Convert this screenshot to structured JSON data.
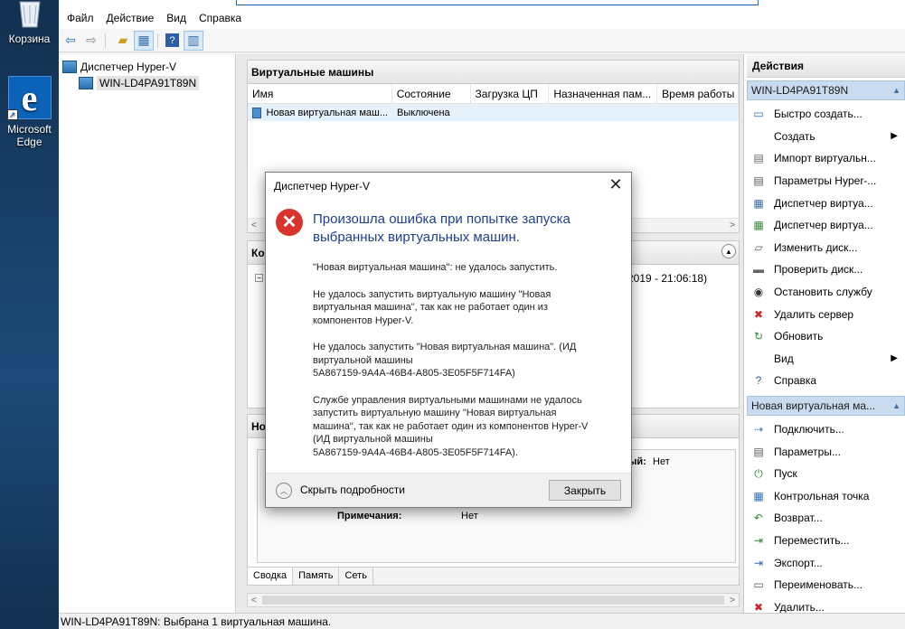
{
  "desktop": {
    "recycle_bin": "Корзина",
    "edge": "Microsoft Edge"
  },
  "menu": [
    "Файл",
    "Действие",
    "Вид",
    "Справка"
  ],
  "tree": {
    "root": "Диспетчер Hyper-V",
    "server": "WIN-LD4PA91T89N"
  },
  "vm_panel": {
    "title": "Виртуальные машины",
    "columns": [
      "Имя",
      "Состояние",
      "Загрузка ЦП",
      "Назначенная пам...",
      "Время работы"
    ],
    "rows": [
      {
        "name": "Новая виртуальная маш...",
        "state": "Выключена",
        "cpu": "",
        "mem": "",
        "uptime": ""
      }
    ]
  },
  "checkpoints_panel": {
    "title": "Ко",
    "date": "2019 - 21:06:18)"
  },
  "details_panel": {
    "title": "Но",
    "net_label": "ый:",
    "net_value": "Нет",
    "notes_label": "Примечания:",
    "notes_value": "Нет",
    "tabs": [
      "Сводка",
      "Память",
      "Сеть"
    ]
  },
  "actions": {
    "header": "Действия",
    "server_section": "WIN-LD4PA91T89N",
    "server_items": [
      {
        "label": "Быстро создать...",
        "icon": "quick-create-icon",
        "sub": false
      },
      {
        "label": "Создать",
        "icon": "none",
        "sub": true
      },
      {
        "label": "Импорт виртуальн...",
        "icon": "import-icon",
        "sub": false
      },
      {
        "label": "Параметры Hyper-...",
        "icon": "settings-icon",
        "sub": false
      },
      {
        "label": "Диспетчер виртуа...",
        "icon": "switch-manager-icon",
        "sub": false
      },
      {
        "label": "Диспетчер виртуа...",
        "icon": "san-manager-icon",
        "sub": false
      },
      {
        "label": "Изменить диск...",
        "icon": "edit-disk-icon",
        "sub": false
      },
      {
        "label": "Проверить диск...",
        "icon": "inspect-disk-icon",
        "sub": false
      },
      {
        "label": "Остановить службу",
        "icon": "stop-service-icon",
        "sub": false
      },
      {
        "label": "Удалить сервер",
        "icon": "remove-server-icon",
        "sub": false
      },
      {
        "label": "Обновить",
        "icon": "refresh-icon",
        "sub": false
      },
      {
        "label": "Вид",
        "icon": "none",
        "sub": true
      },
      {
        "label": "Справка",
        "icon": "help-icon",
        "sub": false
      }
    ],
    "vm_section": "Новая виртуальная ма...",
    "vm_items": [
      {
        "label": "Подключить...",
        "icon": "connect-icon"
      },
      {
        "label": "Параметры...",
        "icon": "vm-settings-icon"
      },
      {
        "label": "Пуск",
        "icon": "start-icon"
      },
      {
        "label": "Контрольная точка",
        "icon": "checkpoint-icon"
      },
      {
        "label": "Возврат...",
        "icon": "revert-icon"
      },
      {
        "label": "Переместить...",
        "icon": "move-icon"
      },
      {
        "label": "Экспорт...",
        "icon": "export-icon"
      },
      {
        "label": "Переименовать...",
        "icon": "rename-icon"
      },
      {
        "label": "Удалить...",
        "icon": "delete-icon"
      }
    ]
  },
  "status": "WIN-LD4PA91T89N:  Выбрана 1 виртуальная машина.",
  "dialog": {
    "title": "Диспетчер Hyper-V",
    "main": "Произошла ошибка при попытке запуска выбранных виртуальных машин.",
    "paragraphs": [
      "\"Новая виртуальная машина\": не удалось запустить.",
      "Не удалось запустить виртуальную машину \"Новая\nвиртуальная машина\", так как не работает один из\nкомпонентов Hyper-V.",
      "Не удалось запустить \"Новая виртуальная машина\". (ИД\nвиртуальной машины\n5A867159-9A4A-46B4-A805-3E05F5F714FA)",
      "Службе управления виртуальными машинами не удалось\nзапустить виртуальную машину \"Новая виртуальная\nмашина\", так как не работает один из компонентов Hyper-V\n(ИД виртуальной машины\n5A867159-9A4A-46B4-A805-3E05F5F714FA)."
    ],
    "toggle": "Скрыть подробности",
    "close_button": "Закрыть"
  },
  "colors": {
    "accent": "#1d3f8f",
    "error": "#d9342b",
    "section": "#c9dcef"
  }
}
